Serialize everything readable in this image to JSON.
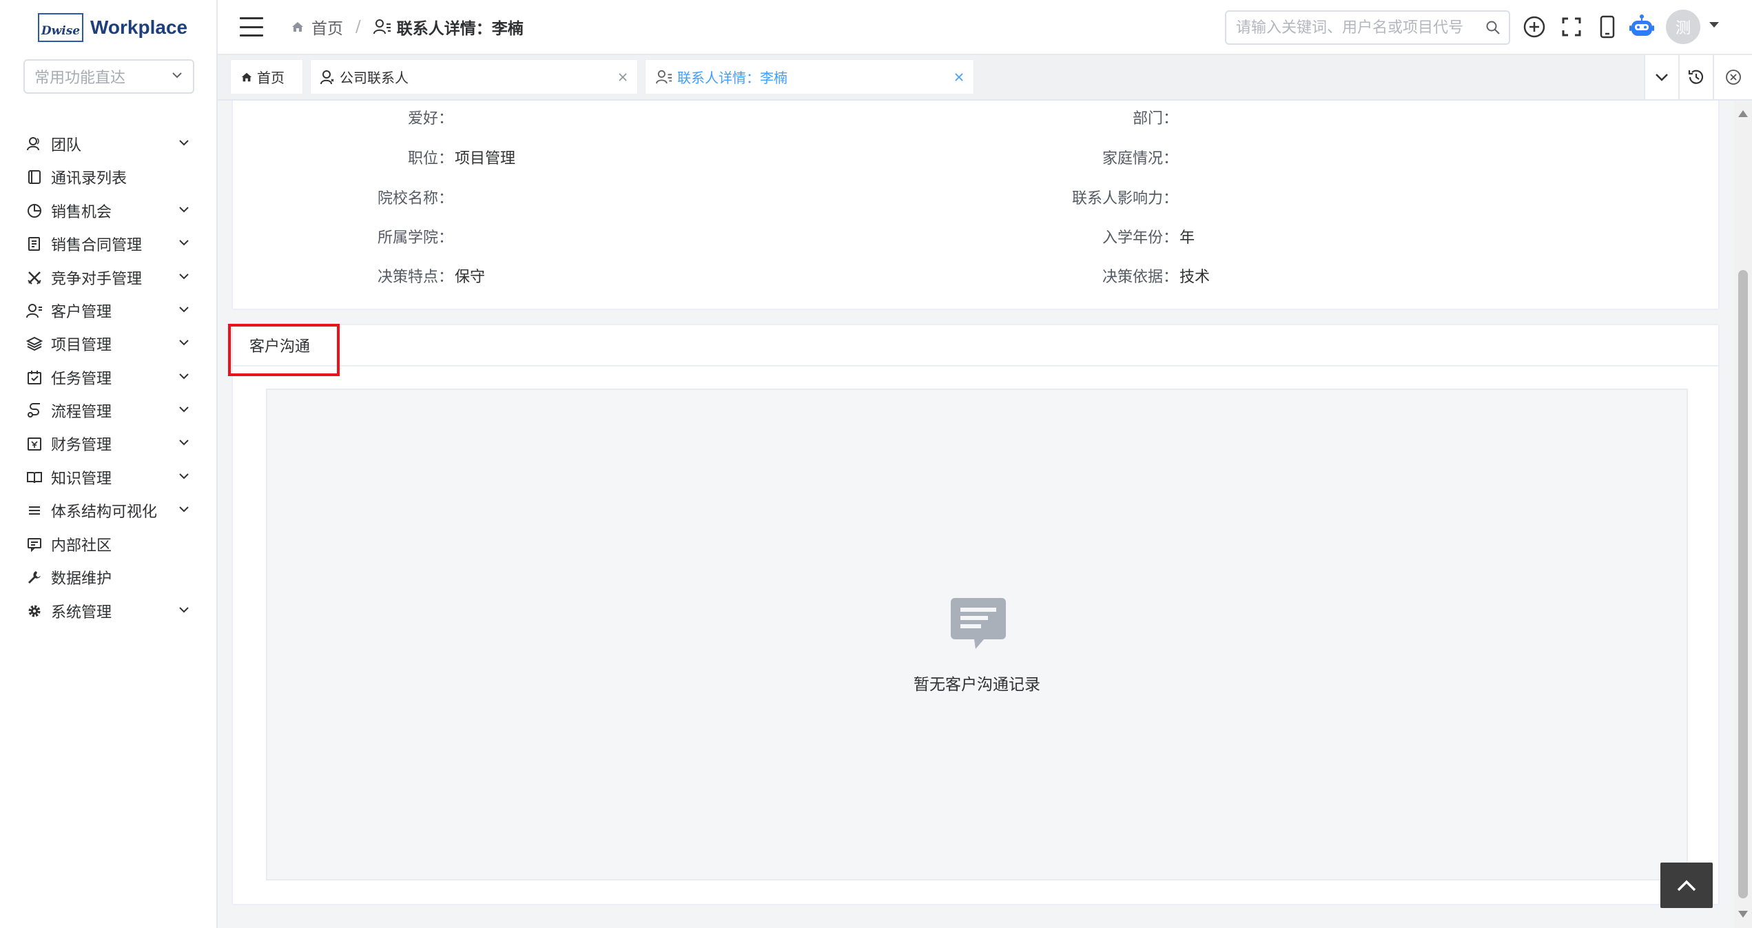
{
  "app": {
    "logo_mark": "Dwise",
    "logo_word": "Workplace"
  },
  "quick_select": {
    "placeholder": "常用功能直达"
  },
  "sidebar": {
    "items": [
      {
        "label": "团队",
        "icon": "team-icon",
        "expandable": true
      },
      {
        "label": "通讯录列表",
        "icon": "address-book-icon",
        "expandable": false
      },
      {
        "label": "销售机会",
        "icon": "pie-chart-icon",
        "expandable": true
      },
      {
        "label": "销售合同管理",
        "icon": "contract-icon",
        "expandable": true
      },
      {
        "label": "竞争对手管理",
        "icon": "crossed-swords-icon",
        "expandable": true
      },
      {
        "label": "客户管理",
        "icon": "customer-icon",
        "expandable": true
      },
      {
        "label": "项目管理",
        "icon": "layers-icon",
        "expandable": true
      },
      {
        "label": "任务管理",
        "icon": "task-icon",
        "expandable": true
      },
      {
        "label": "流程管理",
        "icon": "flow-icon",
        "expandable": true
      },
      {
        "label": "财务管理",
        "icon": "finance-icon",
        "expandable": true
      },
      {
        "label": "知识管理",
        "icon": "book-icon",
        "expandable": true
      },
      {
        "label": "体系结构可视化",
        "icon": "list-icon",
        "expandable": true
      },
      {
        "label": "内部社区",
        "icon": "community-icon",
        "expandable": false
      },
      {
        "label": "数据维护",
        "icon": "wrench-icon",
        "expandable": false
      },
      {
        "label": "系统管理",
        "icon": "gear-icon",
        "expandable": true
      }
    ]
  },
  "header": {
    "breadcrumb_home": "首页",
    "breadcrumb_separator": "/",
    "breadcrumb_current": "联系人详情：李楠",
    "search_placeholder": "请输入关键词、用户名或项目代号",
    "avatar_text": "测"
  },
  "tabs": [
    {
      "label": "首页",
      "icon": "home-icon",
      "closable": false,
      "active": false
    },
    {
      "label": "公司联系人",
      "icon": "contact-icon",
      "closable": true,
      "active": false
    },
    {
      "label": "联系人详情：李楠",
      "icon": "contact-detail-icon",
      "closable": true,
      "active": true
    }
  ],
  "details": {
    "left": [
      {
        "label": "爱好：",
        "value": ""
      },
      {
        "label": "职位：",
        "value": "项目管理"
      },
      {
        "label": "院校名称：",
        "value": ""
      },
      {
        "label": "所属学院：",
        "value": ""
      },
      {
        "label": "决策特点：",
        "value": "保守"
      }
    ],
    "right": [
      {
        "label": "部门：",
        "value": ""
      },
      {
        "label": "家庭情况：",
        "value": ""
      },
      {
        "label": "联系人影响力：",
        "value": ""
      },
      {
        "label": "入学年份：",
        "value": "年"
      },
      {
        "label": "决策依据：",
        "value": "技术"
      }
    ]
  },
  "communication": {
    "title": "客户沟通",
    "empty_text": "暂无客户沟通记录"
  },
  "colors": {
    "accent": "#409eff",
    "highlight": "#e8131b",
    "brand": "#1e3f7a"
  }
}
